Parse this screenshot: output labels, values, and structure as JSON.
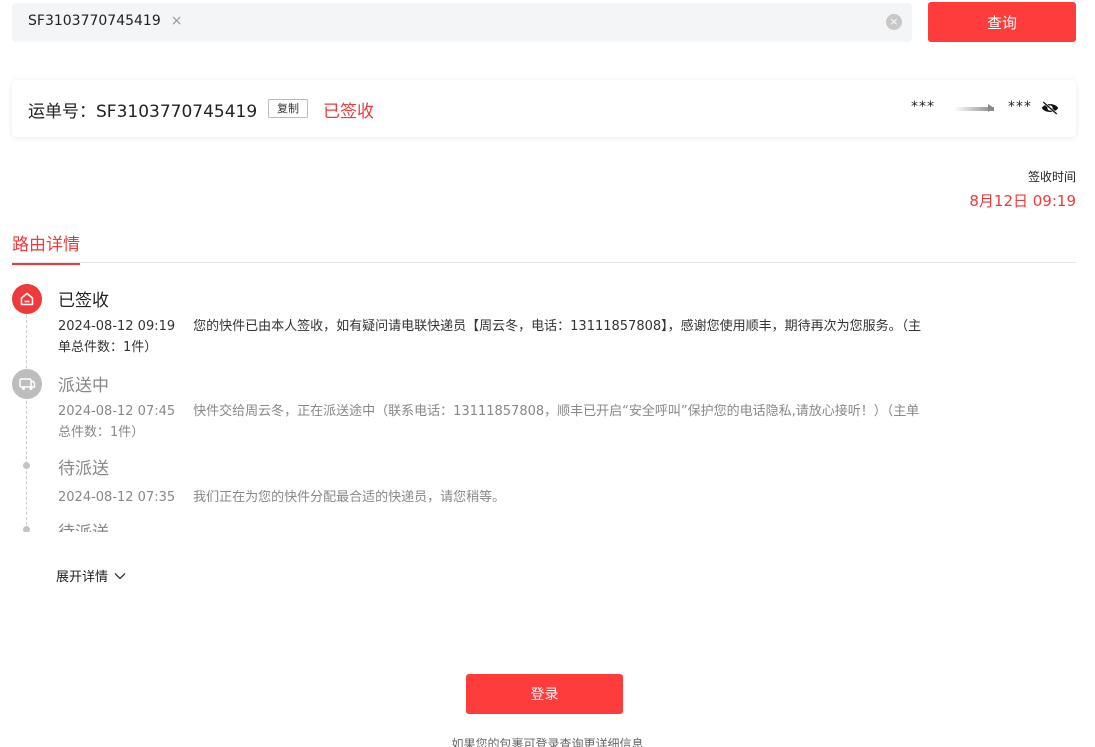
{
  "search": {
    "tag_value": "SF3103770745419",
    "tag_close": "×",
    "clear": "×",
    "button_label": "查询"
  },
  "waybill": {
    "label": "运单号：SF3103770745419",
    "copy_label": "复制",
    "status": "已签收",
    "route_from": "***",
    "route_to": "***"
  },
  "sign": {
    "label": "签收时间",
    "time": "8月12日 09:19"
  },
  "tab": {
    "route_details": "路由详情"
  },
  "timeline": [
    {
      "title": "已签收",
      "time": "2024-08-12 09:19",
      "text": "您的快件已由本人签收，如有疑问请电联快递员【周云冬，电话：13111857808】，感谢您使用顺丰，期待再次为您服务。（主单总件数：1件）",
      "icon": "home-icon"
    },
    {
      "title": "派送中",
      "time": "2024-08-12 07:45",
      "text": "快件交给周云冬，正在派送途中（联系电话：13111857808，顺丰已开启“安全呼叫”保护您的电话隐私,请放心接听！）（主单总件数：1件）",
      "icon": "delivery-van-icon"
    },
    {
      "title": "待派送",
      "time": "2024-08-12 07:35",
      "text": "我们正在为您的快件分配最合适的快递员，请您稍等。"
    },
    {
      "title": "待派送"
    }
  ],
  "expand_label": "展开详情",
  "login": {
    "button_label": "登录",
    "hint": "如果您的包裹可登录查询更详细信息"
  },
  "colors": {
    "accent": "#ee3a3a",
    "button": "#ff3c3c"
  }
}
